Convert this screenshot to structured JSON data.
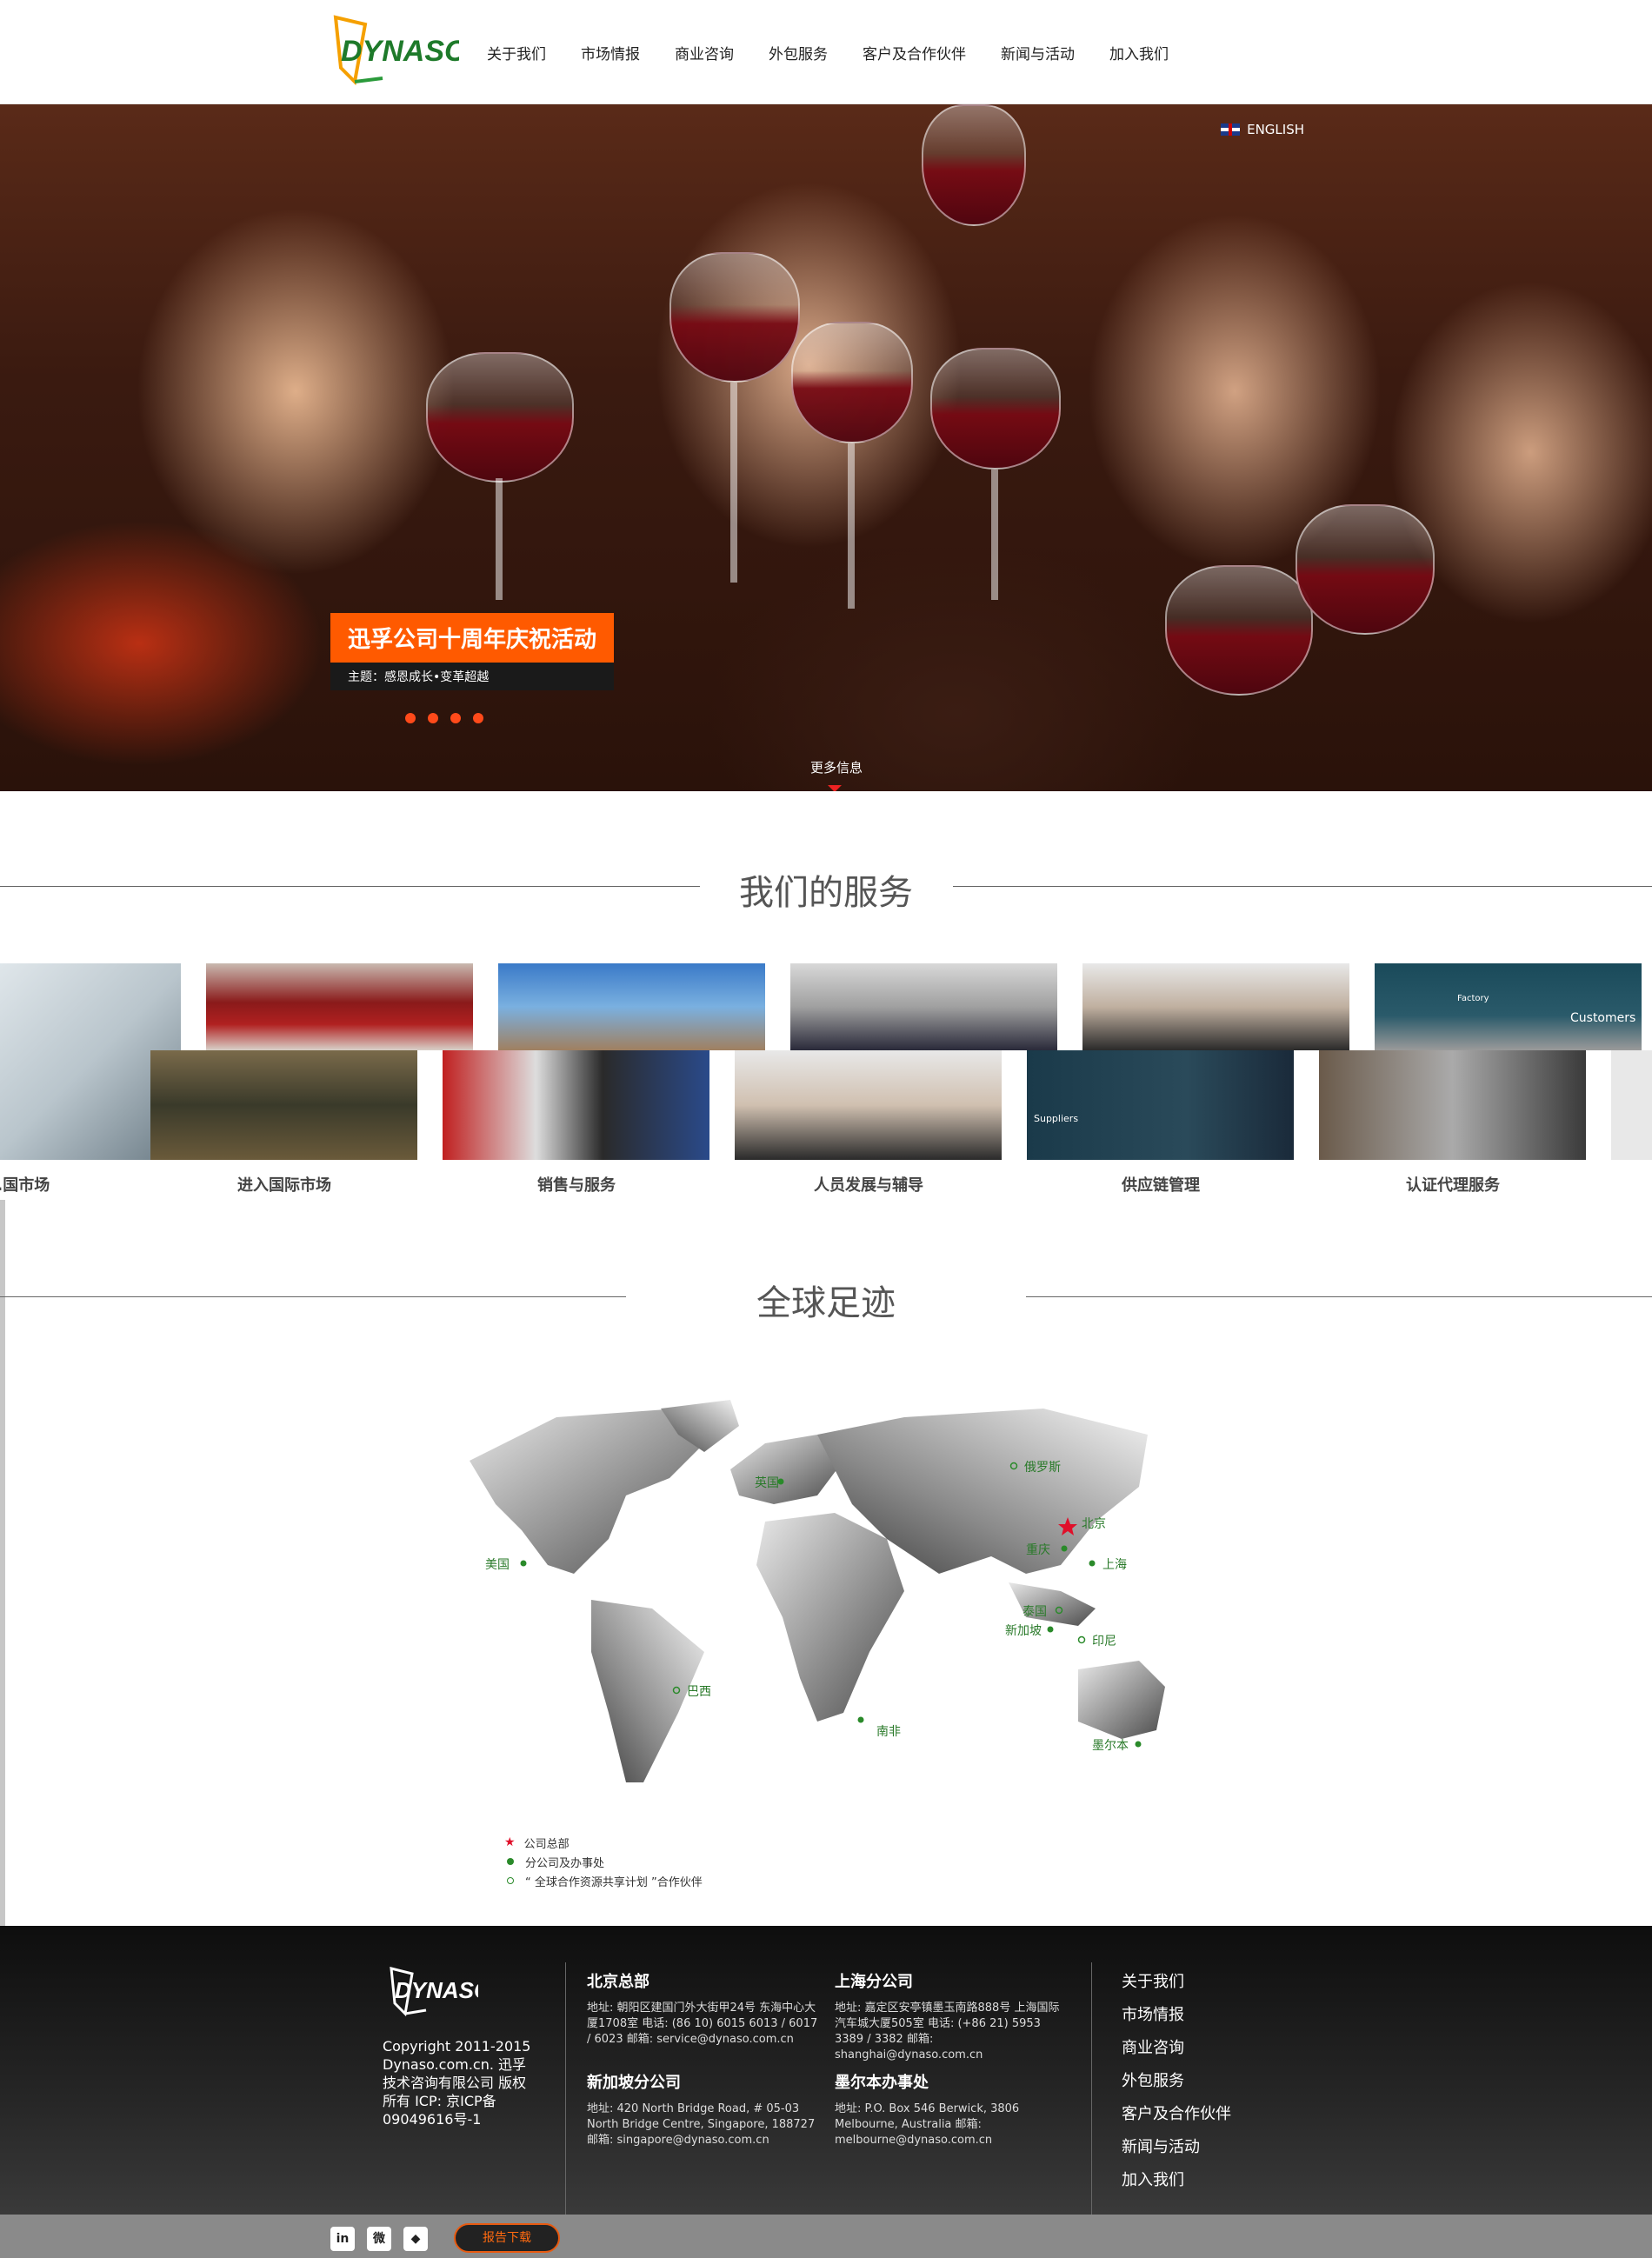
{
  "header": {
    "logo_text": "DYNASO",
    "nav": [
      "关于我们",
      "市场情报",
      "商业咨询",
      "外包服务",
      "客户及合作伙伴",
      "新闻与活动",
      "加入我们"
    ]
  },
  "hero": {
    "language": "ENGLISH",
    "caption_title": "迅孚公司十周年庆祝活动",
    "caption_sub": "主题：感恩成长•变革超越",
    "more_info": "更多信息",
    "slide_count": 4
  },
  "services": {
    "title": "我们的服务",
    "labels": [
      "...国市场",
      "进入国际市场",
      "销售与服务",
      "人员发展与辅导",
      "供应链管理",
      "认证代理服务"
    ],
    "thumb_texts": {
      "customers": "Customers",
      "factory": "Factory",
      "suppliers": "Suppliers"
    }
  },
  "footprint": {
    "title": "全球足迹",
    "locations": [
      {
        "name": "美国",
        "kind": "office"
      },
      {
        "name": "英国",
        "kind": "office"
      },
      {
        "name": "俄罗斯",
        "kind": "partner"
      },
      {
        "name": "北京",
        "kind": "hq"
      },
      {
        "name": "重庆",
        "kind": "office"
      },
      {
        "name": "上海",
        "kind": "office"
      },
      {
        "name": "泰国",
        "kind": "partner"
      },
      {
        "name": "新加坡",
        "kind": "office"
      },
      {
        "name": "印尼",
        "kind": "partner"
      },
      {
        "name": "巴西",
        "kind": "partner"
      },
      {
        "name": "南非",
        "kind": "office"
      },
      {
        "name": "墨尔本",
        "kind": "office"
      }
    ],
    "legend": [
      "公司总部",
      "分公司及办事处",
      "“ 全球合作资源共享计划 ”合作伙伴"
    ],
    "colors": {
      "hq": "#e0102a",
      "office": "#2a8a2a",
      "label": "#2a7a2a"
    }
  },
  "footer": {
    "logo_text": "DYNASO",
    "copyright": "Copyright 2011-2015 Dynaso.com.cn. 迅孚技术咨询有限公司 版权所有 ICP: 京ICP备09049616号-1",
    "offices": [
      {
        "name": "北京总部",
        "text": "地址: 朝阳区建国门外大街甲24号 东海中心大厦1708室 电话: (86 10) 6015 6013 / 6017 / 6023 邮箱: service@dynaso.com.cn"
      },
      {
        "name": "上海分公司",
        "text": "地址: 嘉定区安亭镇墨玉南路888号 上海国际汽车城大厦505室 电话: (+86 21) 5953 3389 / 3382 邮箱: shanghai@dynaso.com.cn"
      },
      {
        "name": "新加坡分公司",
        "text": "地址: 420 North Bridge Road, # 05-03 North Bridge Centre, Singapore, 188727 邮箱: singapore@dynaso.com.cn"
      },
      {
        "name": "墨尔本办事处",
        "text": "地址: P.O. Box 546 Berwick, 3806 Melbourne, Australia 邮箱: melbourne@dynaso.com.cn"
      }
    ],
    "nav": [
      "关于我们",
      "市场情报",
      "商业咨询",
      "外包服务",
      "客户及合作伙伴",
      "新闻与活动",
      "加入我们"
    ]
  },
  "bottom_bar": {
    "social": [
      "in",
      "微",
      "◆"
    ],
    "report_button": "报告下载"
  }
}
